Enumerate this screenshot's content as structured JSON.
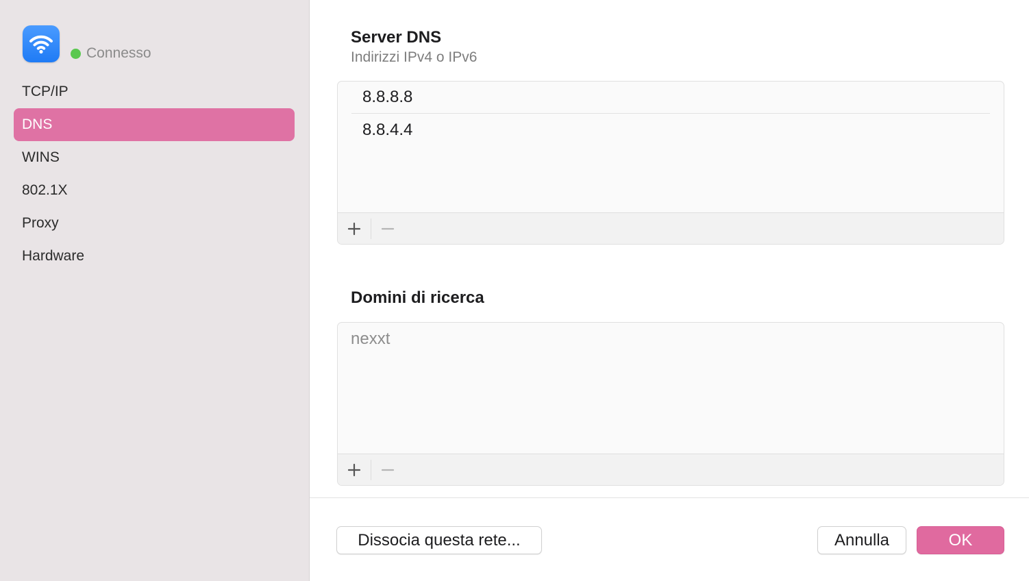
{
  "sidebar": {
    "status": "Connesso",
    "status_color": "#5ac84f",
    "icon": "wifi-icon",
    "items": [
      {
        "label": "TCP/IP",
        "selected": false
      },
      {
        "label": "DNS",
        "selected": true
      },
      {
        "label": "WINS",
        "selected": false
      },
      {
        "label": "802.1X",
        "selected": false
      },
      {
        "label": "Proxy",
        "selected": false
      },
      {
        "label": "Hardware",
        "selected": false
      }
    ]
  },
  "dns": {
    "title": "Server DNS",
    "subtitle": "Indirizzi IPv4 o IPv6",
    "servers": [
      "8.8.8.8",
      "8.8.4.4"
    ],
    "add_symbol": "+",
    "remove_symbol": "−"
  },
  "search_domains": {
    "title": "Domini di ricerca",
    "entries": [
      "nexxt"
    ],
    "add_symbol": "+",
    "remove_symbol": "−"
  },
  "footer": {
    "forget_label": "Dissocia questa rete...",
    "cancel_label": "Annulla",
    "ok_label": "OK"
  },
  "colors": {
    "accent": "#e06a9f",
    "sidebar_selected": "#df72a4",
    "sidebar_bg": "#e9e4e6"
  }
}
